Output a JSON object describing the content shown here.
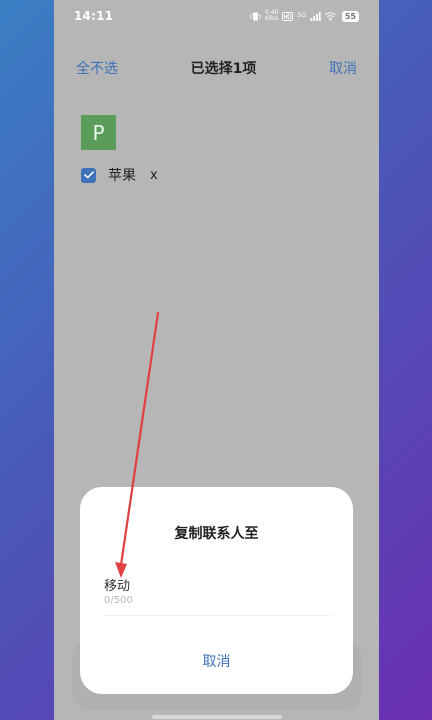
{
  "status_bar": {
    "time": "14:11",
    "speed": "0.40\nKB/s",
    "network": "5G",
    "battery": "55",
    "icons": [
      "vibrate-icon",
      "hd-icon",
      "signal-icon",
      "wifi-icon",
      "battery-icon"
    ]
  },
  "header": {
    "left_action": "全不选",
    "title": "已选择1项",
    "right_action": "取消"
  },
  "contact": {
    "avatar_letter": "P",
    "name": "苹果",
    "mark": "x",
    "checked": true
  },
  "dialog": {
    "title": "复制联系人至",
    "field_value": "移动",
    "counter": "0/500",
    "cancel_label": "取消"
  },
  "colors": {
    "accent": "#3d72b8",
    "avatar": "#5a9d5a",
    "annotation_arrow": "#e04040"
  }
}
